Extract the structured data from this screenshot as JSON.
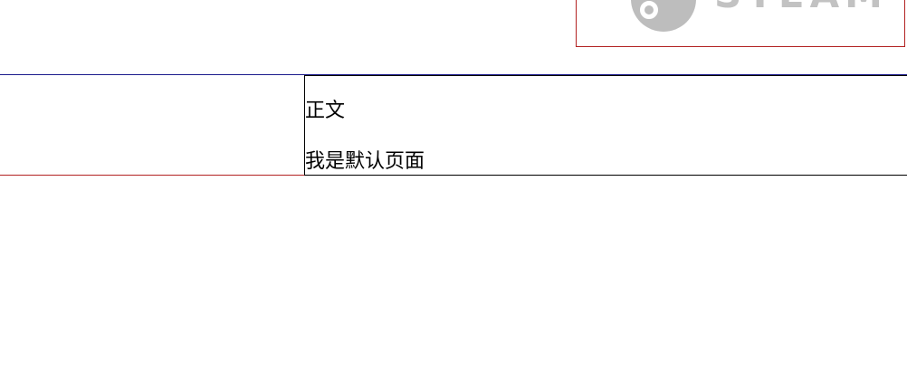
{
  "header": {
    "logo_text": "STEAM",
    "logo_icon": "steam-logo-icon",
    "logo_color": "#bdbdbd",
    "box_border_color": "#b22222"
  },
  "layout_colors": {
    "top_rule": "#1a1a8c",
    "bottom_rule": "#b22222",
    "content_border": "#000000"
  },
  "main": {
    "title": "正文",
    "body": "我是默认页面"
  }
}
